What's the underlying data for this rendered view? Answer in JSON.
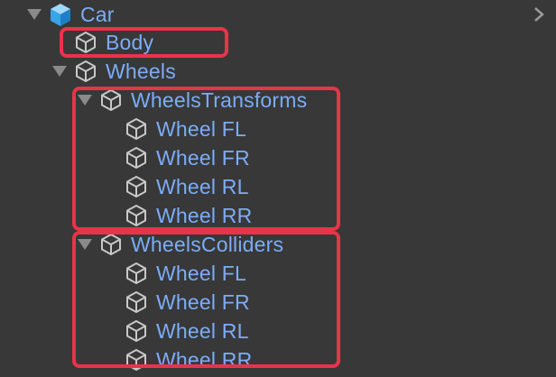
{
  "hierarchy": {
    "root": {
      "label": "Car",
      "icon": "cube-filled-icon"
    },
    "body": {
      "label": "Body",
      "icon": "cube-outline-icon"
    },
    "wheels": {
      "label": "Wheels",
      "icon": "cube-outline-icon"
    },
    "wheels_transforms": {
      "label": "WheelsTransforms",
      "icon": "cube-outline-icon",
      "children": [
        {
          "label": "Wheel FL"
        },
        {
          "label": "Wheel FR"
        },
        {
          "label": "Wheel RL"
        },
        {
          "label": "Wheel RR"
        }
      ]
    },
    "wheels_colliders": {
      "label": "WheelsColliders",
      "icon": "cube-outline-icon",
      "children": [
        {
          "label": "Wheel FL"
        },
        {
          "label": "Wheel FR"
        },
        {
          "label": "Wheel RL"
        },
        {
          "label": "Wheel RR"
        }
      ]
    }
  },
  "colors": {
    "background": "#383838",
    "label": "#7cacf8",
    "highlight": "#e8344a",
    "icon": "#c8c8c8"
  }
}
